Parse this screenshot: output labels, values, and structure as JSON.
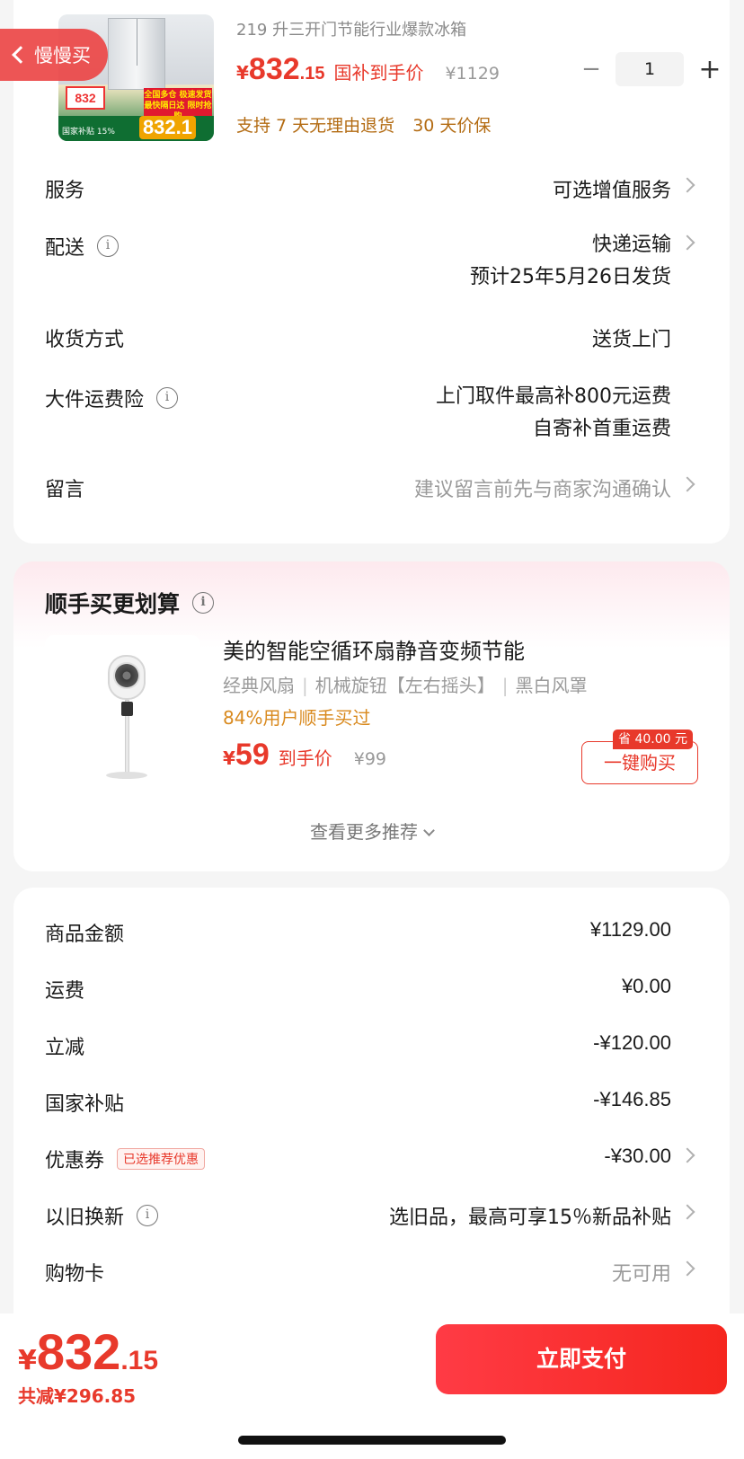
{
  "back": {
    "label": "慢慢买"
  },
  "product": {
    "title": "219 升三开门节能行业爆款冰箱",
    "price_yen": "¥",
    "price_main": "832",
    "price_dec": ".15",
    "price_label": "国补到手价",
    "orig_price": "¥1129",
    "quantity": "1",
    "qty_minus": "−",
    "qty_plus": "+",
    "policy": [
      "支持 7 天无理由退货",
      "30 天价保"
    ],
    "image_texts": {
      "tag_price": "832",
      "badge": "全国多仓 极速发货 最快隔日达 限时抢购",
      "bottom_price": "832.1",
      "bottom_left": "国家补贴 15%"
    }
  },
  "order_rows": [
    {
      "label": "服务",
      "value": "可选增值服务",
      "arrow": true
    },
    {
      "label": "配送",
      "info": true,
      "value": "快递运输",
      "value2": "预计25年5月26日发货",
      "arrow": true
    },
    {
      "label": "收货方式",
      "value": "送货上门",
      "arrow": false
    },
    {
      "label": "大件运费险",
      "info": true,
      "value": "上门取件最高补800元运费",
      "value2": "自寄补首重运费",
      "arrow": false
    },
    {
      "label": "留言",
      "value": "建议留言前先与商家沟通确认",
      "arrow": true,
      "muted": true
    }
  ],
  "recommend": {
    "title": "顺手买更划算",
    "name": "美的智能空循环扇静音变频节能",
    "spec": [
      "经典风扇",
      "机械旋钮【左右摇头】",
      "黑白风罩"
    ],
    "social": "84%用户顺手买过",
    "price_yen": "¥",
    "price": "59",
    "price_label": "到手价",
    "orig_price": "¥99",
    "save_badge": "省 40.00 元",
    "buy_label": "一键购买",
    "more_label": "查看更多推荐"
  },
  "summary": [
    {
      "label": "商品金额",
      "value": "¥1129.00",
      "color": "#1a1a1a"
    },
    {
      "label": "运费",
      "value": "¥0.00",
      "color": "#1a1a1a"
    },
    {
      "label": "立减",
      "value": "-¥120.00",
      "color": "#e8392b"
    },
    {
      "label": "国家补贴",
      "value": "-¥146.85",
      "color": "#e8392b"
    },
    {
      "label": "优惠券",
      "badge": "已选推荐优惠",
      "value": "-¥30.00",
      "color": "#e8392b",
      "arrow": true
    },
    {
      "label": "以旧换新",
      "info": true,
      "value": "选旧品，最高可享15％新品补贴",
      "color": "#1a1a1a",
      "arrow": true
    },
    {
      "label": "购物卡",
      "value": "无可用",
      "color": "#9a9a9a",
      "arrow": true
    }
  ],
  "footer": {
    "total_yen": "¥",
    "total_main": "832",
    "total_dec": ".15",
    "total_save": "共减¥296.85",
    "pay_label": "立即支付"
  },
  "colors": {
    "accent": "#e8392b",
    "policy": "#b36b12",
    "social": "#d98a1f"
  },
  "icons": {
    "back": "chevron-left-icon",
    "info": "info-circle-icon",
    "arrow": "chevron-right-icon",
    "more": "chevron-down-icon"
  }
}
